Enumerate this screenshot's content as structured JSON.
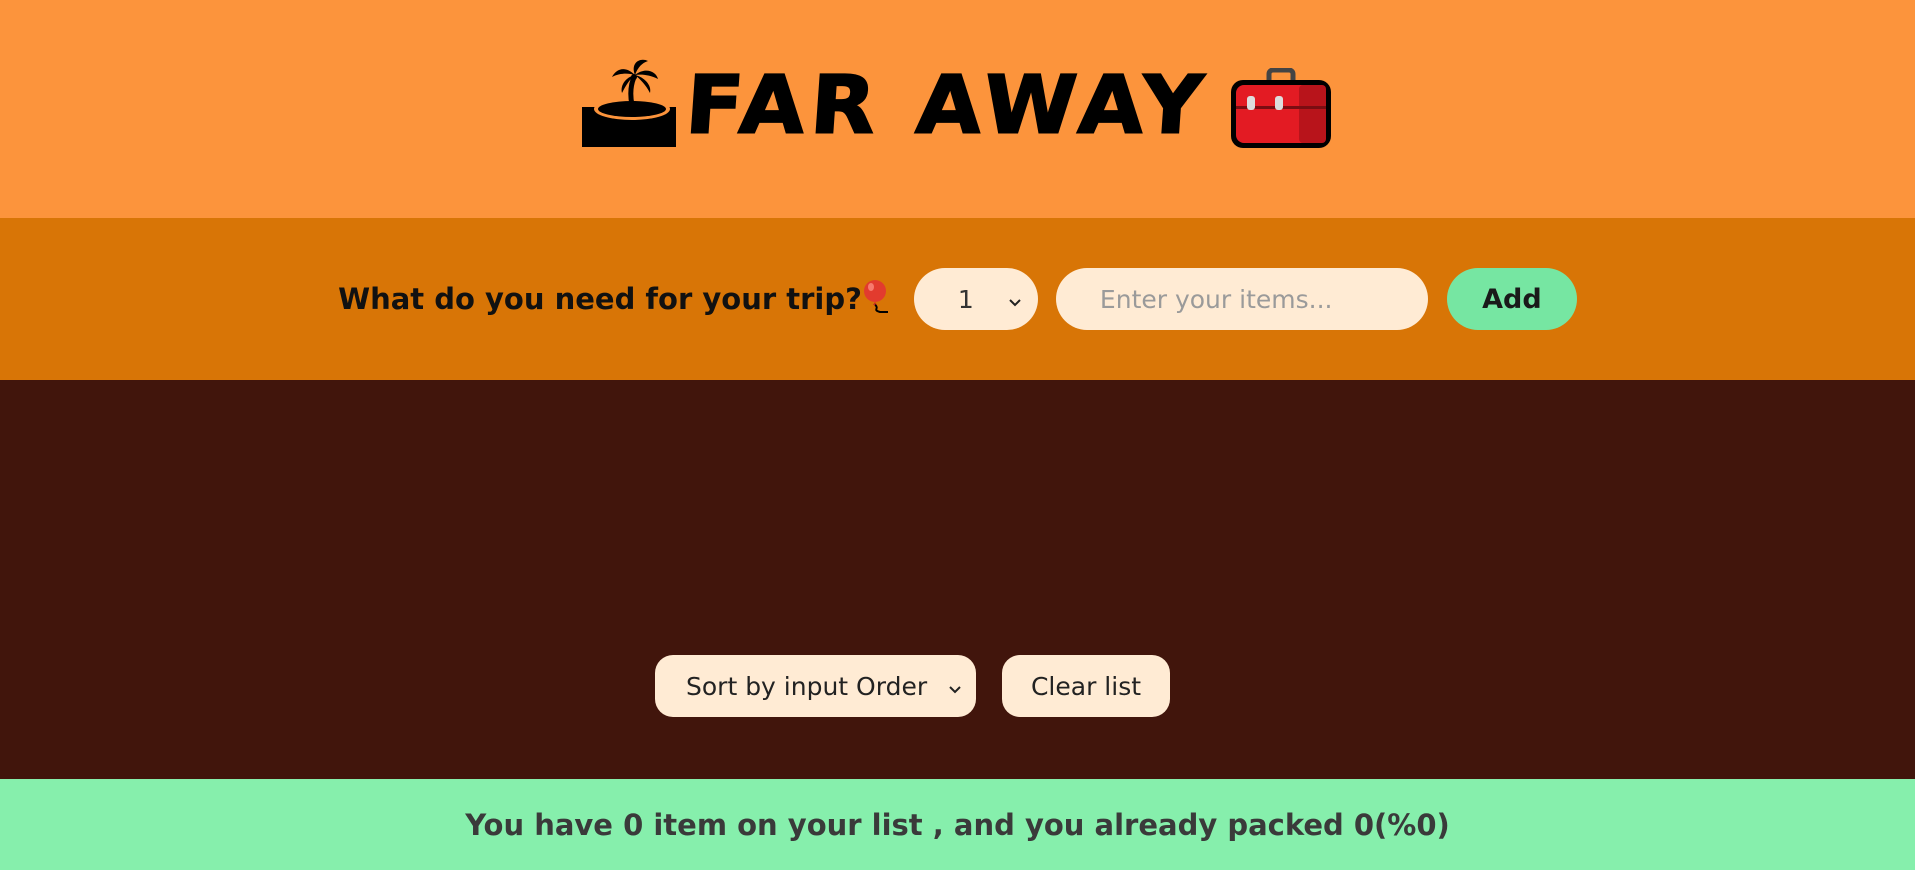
{
  "header": {
    "title": "FAR AWAY",
    "left_icon": "island-palm-icon",
    "right_icon": "suitcase-icon"
  },
  "form": {
    "question": "What do you need for your trip?",
    "question_icon": "balloon-icon",
    "quantity_selected": "1",
    "item_placeholder": "Enter your items...",
    "add_label": "Add"
  },
  "list": {
    "sort_selected": "Sort by input Order",
    "clear_label": "Clear list"
  },
  "stats": {
    "text": "You have 0 item on your list , and you already packed 0(%0)"
  },
  "colors": {
    "header_bg": "#fc943c",
    "form_bg": "#d87506",
    "list_bg": "#41150c",
    "stats_bg": "#86efac",
    "accent_green": "#76e6a2",
    "input_bg": "#ffebd4"
  }
}
